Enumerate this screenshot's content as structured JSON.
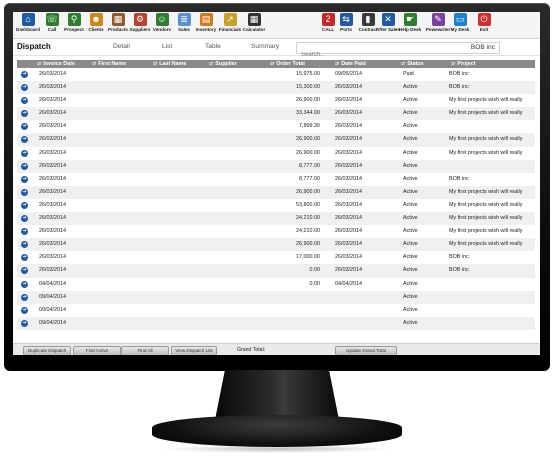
{
  "toolbar": [
    {
      "label": "Dashboard",
      "icon": "home-icon",
      "color": "#1f5aa3",
      "glyph": "⌂"
    },
    {
      "label": "Call",
      "icon": "phone-icon",
      "color": "#2e7d32",
      "glyph": "☏"
    },
    {
      "label": "Prospect",
      "icon": "prospect-icon",
      "color": "#2e7d32",
      "glyph": "⚲"
    },
    {
      "label": "Clients",
      "icon": "clients-icon",
      "color": "#c98a1b",
      "glyph": "☻"
    },
    {
      "label": "Products",
      "icon": "products-icon",
      "color": "#8d5a2b",
      "glyph": "▦"
    },
    {
      "label": "Suppliers",
      "icon": "suppliers-icon",
      "color": "#b8432f",
      "glyph": "⚙"
    },
    {
      "label": "Vendors",
      "icon": "vendors-icon",
      "color": "#2e7d32",
      "glyph": "☺"
    },
    {
      "label": "Sales",
      "icon": "sales-icon",
      "color": "#5b8fd1",
      "glyph": "≣"
    },
    {
      "label": "Inventory",
      "icon": "inventory-icon",
      "color": "#d07a1a",
      "glyph": "▤"
    },
    {
      "label": "Financials",
      "icon": "financials-icon",
      "color": "#c7a02a",
      "glyph": "↗"
    },
    {
      "label": "Calculator",
      "icon": "calculator-icon",
      "color": "#333333",
      "glyph": "▦"
    },
    {
      "label": "CALL",
      "icon": "call-number-icon",
      "color": "#c62828",
      "glyph": "2"
    },
    {
      "label": "Ports",
      "icon": "ports-icon",
      "color": "#1f5aa3",
      "glyph": "⇆"
    },
    {
      "label": "Contract",
      "icon": "contract-icon",
      "color": "#3a3a3a",
      "glyph": "▮"
    },
    {
      "label": "After Sales",
      "icon": "tools-icon",
      "color": "#1f5aa3",
      "glyph": "✕"
    },
    {
      "label": "Help Desk",
      "icon": "helpdesk-icon",
      "color": "#2e7d32",
      "glyph": "☛"
    },
    {
      "label": "Powewriter",
      "icon": "pen-icon",
      "color": "#7b3fa0",
      "glyph": "✎"
    },
    {
      "label": "My Desk",
      "icon": "monitor-icon",
      "color": "#1f7fd1",
      "glyph": "▭"
    },
    {
      "label": "Exit",
      "icon": "power-icon",
      "color": "#d32f2f",
      "glyph": "⏻"
    }
  ],
  "titlebar": {
    "title": "Dispatch",
    "links": [
      "Detail",
      "List",
      "Table",
      "Summary"
    ],
    "search_placeholder": "Search..",
    "user": "BOB inc"
  },
  "columns": [
    "Invoice Date",
    "First Name",
    "Last Name",
    "Supplier",
    "Order Total",
    "Date Paid",
    "Status",
    "Project"
  ],
  "rows": [
    [
      "26/03/2014",
      "",
      "",
      "",
      "15,975.00",
      "09/05/2014",
      "Paid",
      "BOB inc"
    ],
    [
      "26/03/2014",
      "",
      "",
      "",
      "15,300.00",
      "26/03/2014",
      "Active",
      "BOB inc"
    ],
    [
      "26/03/2014",
      "",
      "",
      "",
      "26,900.00",
      "26/03/2014",
      "Active",
      "My first projects wish will really"
    ],
    [
      "26/03/2014",
      "",
      "",
      "",
      "33,344.00",
      "26/03/2014",
      "Active",
      "My first projects wish will really"
    ],
    [
      "26/03/2014",
      "",
      "",
      "",
      "7,899.30",
      "26/03/2014",
      "Active",
      ""
    ],
    [
      "26/03/2014",
      "",
      "",
      "",
      "26,900.00",
      "26/03/2014",
      "Active",
      "My first projects wish will really"
    ],
    [
      "26/03/2014",
      "",
      "",
      "",
      "26,900.00",
      "26/03/2014",
      "Active",
      "My first projects wish will really"
    ],
    [
      "26/03/2014",
      "",
      "",
      "",
      "8,777.00",
      "26/03/2014",
      "Active",
      ""
    ],
    [
      "26/03/2014",
      "",
      "",
      "",
      "8,777.00",
      "26/03/2014",
      "Active",
      "BOB inc"
    ],
    [
      "26/03/2014",
      "",
      "",
      "",
      "26,900.00",
      "26/03/2014",
      "Active",
      "My first projects wish will really"
    ],
    [
      "26/03/2014",
      "",
      "",
      "",
      "53,800.00",
      "26/03/2014",
      "Active",
      "My first projects wish will really"
    ],
    [
      "26/03/2014",
      "",
      "",
      "",
      "24,210.00",
      "26/03/2014",
      "Active",
      "My first projects wish will really"
    ],
    [
      "26/03/2014",
      "",
      "",
      "",
      "24,210.00",
      "26/03/2014",
      "Active",
      "My first projects wish will really"
    ],
    [
      "26/03/2014",
      "",
      "",
      "",
      "26,900.00",
      "26/03/2014",
      "Active",
      "My first projects wish will really"
    ],
    [
      "26/03/2014",
      "",
      "",
      "",
      "17,000.00",
      "26/03/2014",
      "Active",
      "BOB inc"
    ],
    [
      "26/03/2014",
      "",
      "",
      "",
      "0.00",
      "26/03/2014",
      "Active",
      "BOB inc"
    ],
    [
      "04/04/2014",
      "",
      "",
      "",
      "0.00",
      "04/04/2014",
      "Active",
      ""
    ],
    [
      "09/04/2014",
      "",
      "",
      "",
      "",
      "",
      "Active",
      ""
    ],
    [
      "09/04/2014",
      "",
      "",
      "",
      "",
      "",
      "Active",
      ""
    ],
    [
      "09/04/2014",
      "",
      "",
      "",
      "",
      "",
      "Active",
      ""
    ]
  ],
  "footer": {
    "buttons": [
      "Duplicate Dispatch",
      "Find Active",
      "Find All",
      "View Dispatch List"
    ],
    "grand_total_label": "Grand Total:",
    "update_button": "Update Grand Total"
  }
}
